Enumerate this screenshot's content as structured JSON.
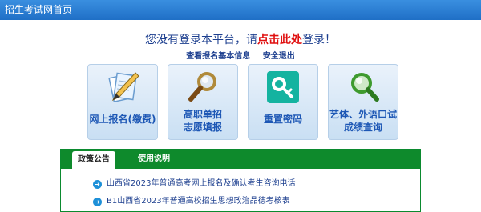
{
  "header": {
    "title": "招生考试网首页"
  },
  "notice": {
    "prefix": "您没有登录本平台，请",
    "click": "点击此处",
    "suffix": "登录！"
  },
  "links": {
    "view_info": "查看报名基本信息",
    "logout": "安全退出"
  },
  "tiles": [
    {
      "label_line1": "网上报名(缴费)",
      "label_line2": "",
      "icon": "pen-paper-icon"
    },
    {
      "label_line1": "高职单招",
      "label_line2": "志愿填报",
      "icon": "magnifier-icon"
    },
    {
      "label_line1": "重置密码",
      "label_line2": "",
      "icon": "key-icon"
    },
    {
      "label_line1": "艺体、外语口试",
      "label_line2": "成绩查询",
      "icon": "search-icon"
    }
  ],
  "panel": {
    "tabs": [
      "政策公告",
      "使用说明"
    ],
    "news": [
      "山西省2023年普通高考网上报名及确认考生咨询电话",
      "B1山西省2023年普通高校招生思想政治品德考核表"
    ]
  },
  "colors": {
    "header": "#1f6fc6",
    "accent_red": "#e01010",
    "panel_green": "#0e8a2c"
  }
}
